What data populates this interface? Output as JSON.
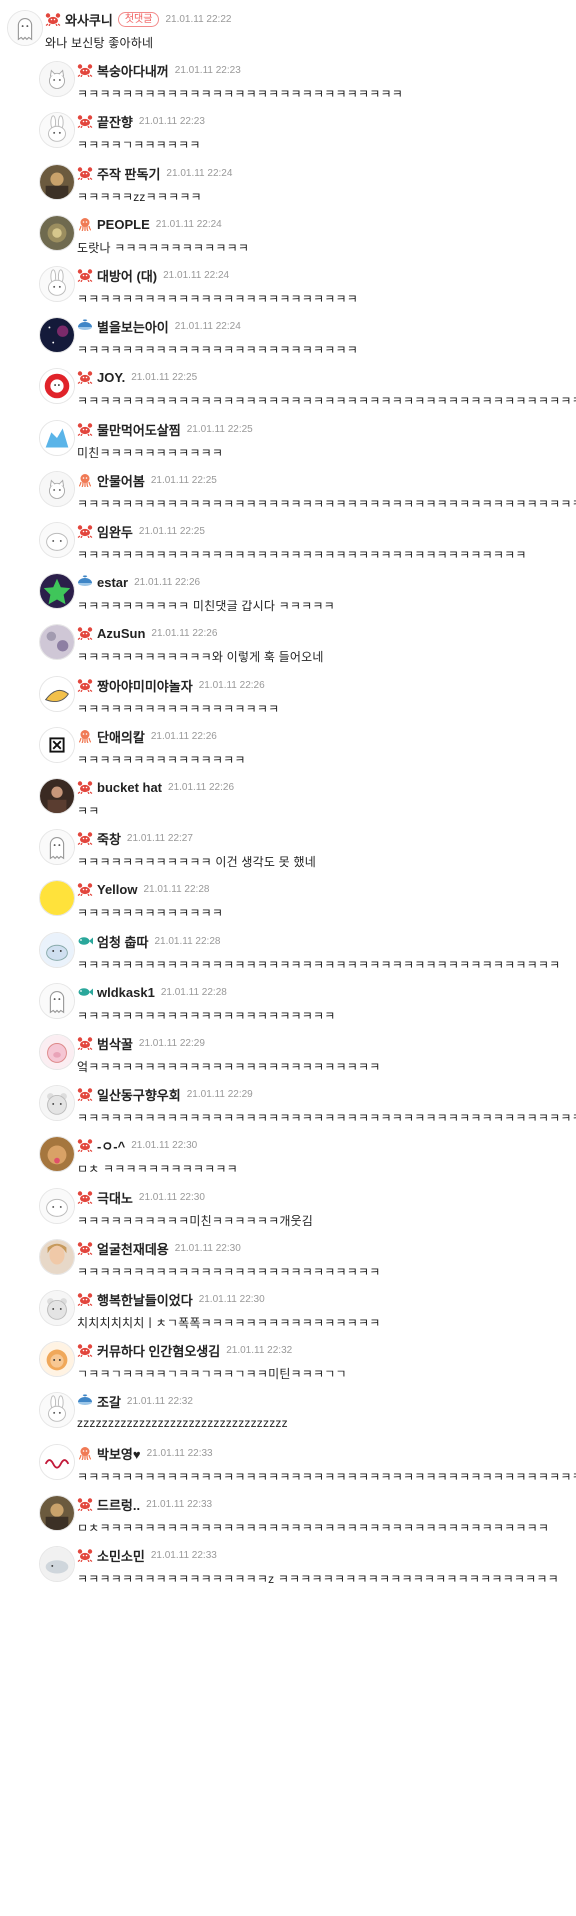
{
  "comments": [
    {
      "nick": "와사쿠니",
      "time": "21.01.11 22:22",
      "text": "와나 보신탕 좋아하네",
      "badge": "첫댓글",
      "level": "crab",
      "avatar": "ghost-avatar",
      "reply": false
    },
    {
      "nick": "복숭아다내꺼",
      "time": "21.01.11 22:23",
      "text": "ㅋㅋㅋㅋㅋㅋㅋㅋㅋㅋㅋㅋㅋㅋㅋㅋㅋㅋㅋㅋㅋㅋㅋㅋㅋㅋㅋㅋㅋ",
      "level": "crab",
      "avatar": "cat-avatar",
      "reply": true
    },
    {
      "nick": "끝잔향",
      "time": "21.01.11 22:23",
      "text": "ㅋㅋㅋㅋㄱㅋㅋㅋㅋㅋㅋ",
      "level": "crab",
      "avatar": "rabbit-avatar",
      "reply": true
    },
    {
      "nick": "주작 판독기",
      "time": "21.01.11 22:24",
      "text": "ㅋㅋㅋㅋㅋzzㅋㅋㅋㅋㅋ",
      "level": "crab",
      "avatar": "photo-avatar",
      "reply": true
    },
    {
      "nick": "PEOPLE",
      "time": "21.01.11 22:24",
      "text": "도랏나 ㅋㅋㅋㅋㅋㅋㅋㅋㅋㅋㅋㅋ",
      "level": "octopus",
      "avatar": "mosaic-avatar",
      "reply": true
    },
    {
      "nick": "대방어 (대)",
      "time": "21.01.11 22:24",
      "text": "ㅋㅋㅋㅋㅋㅋㅋㅋㅋㅋㅋㅋㅋㅋㅋㅋㅋㅋㅋㅋㅋㅋㅋㅋㅋ",
      "level": "crab",
      "avatar": "rabbit-avatar",
      "reply": true
    },
    {
      "nick": "별을보는아이",
      "time": "21.01.11 22:24",
      "text": "ㅋㅋㅋㅋㅋㅋㅋㅋㅋㅋㅋㅋㅋㅋㅋㅋㅋㅋㅋㅋㅋㅋㅋㅋㅋ",
      "level": "whale",
      "avatar": "space-avatar",
      "reply": true
    },
    {
      "nick": "JOY.",
      "time": "21.01.11 22:25",
      "text": "ㅋㅋㅋㅋㅋㅋㅋㅋㅋㅋㅋㅋㅋㅋㅋㅋㅋㅋㅋㅋㅋㅋㅋㅋㅋㅋㅋㅋㅋㅋㅋㅋㅋㅋㅋㅋㅋㅋㅋㅋㅋㅋㅋㅋㅋthl발ㅋㅋ",
      "level": "crab",
      "avatar": "red-avatar",
      "reply": true
    },
    {
      "nick": "물만먹어도살찜",
      "time": "21.01.11 22:25",
      "text": "미친ㅋㅋㅋㅋㅋㅋㅋㅋㅋㅋㅋ",
      "level": "crab",
      "avatar": "blue-avatar",
      "reply": true
    },
    {
      "nick": "안물어봄",
      "time": "21.01.11 22:25",
      "text": "ㅋㅋㅋㅋㅋㅋㅋㅋㅋㅋㅋㅋㅋㅋㅋㅋㅋㅋㅋㅋㅋㅋㅋㅋㅋㅋㅋㅋㅋㅋㅋㅋㅋㅋㅋㅋㅋㅋㅋㅋㅋㅋㅋㅋㅋㅋㅋㅋㅋ",
      "level": "octopus",
      "avatar": "cat-avatar",
      "reply": true
    },
    {
      "nick": "임완두",
      "time": "21.01.11 22:25",
      "text": "ㅋㅋㅋㅋㅋㅋㅋㅋㅋㅋㅋㅋㅋㅋㅋㅋㅋㅋㅋㅋㅋㅋㅋㅋㅋㅋㅋㅋㅋㅋㅋㅋㅋㅋㅋㅋㅋㅋㅋㅋ",
      "level": "crab",
      "avatar": "blob-avatar",
      "reply": true
    },
    {
      "nick": "estar",
      "time": "21.01.11 22:26",
      "text": "ㅋㅋㅋㅋㅋㅋㅋㅋㅋㅋ 미친댓글 갑시다 ㅋㅋㅋㅋㅋ",
      "level": "whale",
      "avatar": "star-avatar",
      "reply": true
    },
    {
      "nick": "AzuSun",
      "time": "21.01.11 22:26",
      "text": "ㅋㅋㅋㅋㅋㅋㅋㅋㅋㅋㅋㅋ와 이렇게 훅 들어오네",
      "level": "crab",
      "avatar": "floral-avatar",
      "reply": true
    },
    {
      "nick": "짱아야미미야놀자",
      "time": "21.01.11 22:26",
      "text": "ㅋㅋㅋㅋㅋㅋㅋㅋㅋㅋㅋㅋㅋㅋㅋㅋㅋㅋ",
      "level": "crab",
      "avatar": "sketch-avatar",
      "reply": true
    },
    {
      "nick": "단애의칼",
      "time": "21.01.11 22:26",
      "text": "ㅋㅋㅋㅋㅋㅋㅋㅋㅋㅋㅋㅋㅋㅋㅋ",
      "level": "octopus",
      "avatar": "box-avatar",
      "reply": true
    },
    {
      "nick": "bucket hat",
      "time": "21.01.11 22:26",
      "text": "ㅋㅋ",
      "level": "crab",
      "avatar": "person-avatar",
      "reply": true
    },
    {
      "nick": "죽창",
      "time": "21.01.11 22:27",
      "text": "ㅋㅋㅋㅋㅋㅋㅋㅋㅋㅋㅋㅋ 이건 생각도 못 했네",
      "level": "crab",
      "avatar": "ghost-avatar",
      "reply": true
    },
    {
      "nick": "Yellow",
      "time": "21.01.11 22:28",
      "text": "ㅋㅋㅋㅋㅋㅋㅋㅋㅋㅋㅋㅋㅋ",
      "level": "crab",
      "avatar": "yellow-avatar",
      "reply": true
    },
    {
      "nick": "엄청 춥따",
      "time": "21.01.11 22:28",
      "text": "ㅋㅋㅋㅋㅋㅋㅋㅋㅋㅋㅋㅋㅋㅋㅋㅋㅋㅋㅋㅋㅋㅋㅋㅋㅋㅋㅋㅋㅋㅋㅋㅋㅋㅋㅋㅋㅋㅋㅋㅋㅋㅋㅋ",
      "level": "fish",
      "avatar": "seal-avatar",
      "reply": true
    },
    {
      "nick": "wldkask1",
      "time": "21.01.11 22:28",
      "text": "ㅋㅋㅋㅋㅋㅋㅋㅋㅋㅋㅋㅋㅋㅋㅋㅋㅋㅋㅋㅋㅋㅋㅋ",
      "level": "fish",
      "avatar": "ghost-avatar",
      "reply": true
    },
    {
      "nick": "범삭꿀",
      "time": "21.01.11 22:29",
      "text": "엌ㅋㅋㅋㅋㅋㅋㅋㅋㅋㅋㅋㅋㅋㅋㅋㅋㅋㅋㅋㅋㅋㅋㅋㅋㅋㅋ",
      "level": "crab",
      "avatar": "pig-avatar",
      "reply": true
    },
    {
      "nick": "일산동구향우회",
      "time": "21.01.11 22:29",
      "text": "ㅋㅋㅋㅋㅋㅋㅋㅋㅋㅋㅋㅋㅋㅋㅋㅋㅋㅋㅋㅋㅋㅋㅋㅋㅋㅋㅋㅋㅋㅋㅋㅋㅋㅋㅋㅋㅋㅋㅋㅋㅋㅋㅋㅋㅋㅋㅋㅋㅋㅋ",
      "level": "crab",
      "avatar": "bear-avatar",
      "reply": true
    },
    {
      "nick": "-ㅇ-^",
      "time": "21.01.11 22:30",
      "text": "ㅁㅊ ㅋㅋㅋㅋㅋㅋㅋㅋㅋㅋㅋㅋ",
      "level": "crab",
      "avatar": "dog-avatar",
      "reply": true
    },
    {
      "nick": "극대노",
      "time": "21.01.11 22:30",
      "text": "ㅋㅋㅋㅋㅋㅋㅋㅋㅋㅋ미친ㅋㅋㅋㅋㅋㅋ개웃김",
      "level": "crab",
      "avatar": "blob-avatar",
      "reply": true
    },
    {
      "nick": "얼굴천재데용",
      "time": "21.01.11 22:30",
      "text": "ㅋㅋㅋㅋㅋㅋㅋㅋㅋㅋㅋㅋㅋㅋㅋㅋㅋㅋㅋㅋㅋㅋㅋㅋㅋㅋㅋ",
      "level": "crab",
      "avatar": "face-avatar",
      "reply": true
    },
    {
      "nick": "행복한날들이었다",
      "time": "21.01.11 22:30",
      "text": "치치치치치치ㅣㅊㄱ폭폭ㅋㅋㅋㅋㅋㅋㅋㅋㅋㅋㅋㅋㅋㅋㅋㅋ",
      "level": "crab",
      "avatar": "bear-avatar",
      "reply": true
    },
    {
      "nick": "커뮤하다 인간혐오생김",
      "time": "21.01.11 22:32",
      "text": "ㄱㅋㅋㄱㅋㅋㅋㅋㄱㅋㅋㄱㅋㅋㄱㅋㅋ미틴ㅋㅋㅋㄱㄱ",
      "level": "crab",
      "avatar": "lion-avatar",
      "reply": true
    },
    {
      "nick": "조갈",
      "time": "21.01.11 22:32",
      "text": "zzzzzzzzzzzzzzzzzzzzzzzzzzzzzzzzzz",
      "level": "whale",
      "avatar": "rabbit-avatar",
      "reply": true
    },
    {
      "nick": "박보영♥",
      "time": "21.01.11 22:33",
      "text": "ㅋㅋㅋㅋㅋㅋㅋㅋㅋㅋㅋㅋㅋㅋㅋㅋㅋㅋㅋㅋㅋㅋㅋㅋㅋㅋㅋㅋㅋㅋㅋㅋㅋㅋㅋㅋㅋㅋㅋㅋㅋㅋㅋㅋㅋㅋㅋㅋㅋㅋ",
      "level": "octopus",
      "avatar": "sign-avatar",
      "reply": true
    },
    {
      "nick": "드르렁..",
      "time": "21.01.11 22:33",
      "text": "ㅁㅊㅋㅋㅋㅋㅋㅋㅋㅋㅋㅋㅋㅋㅋㅋㅋㅋㅋㅋㅋㅋㅋㅋㅋㅋㅋㅋㅋㅋㅋㅋㅋㅋㅋㅋㅋㅋㅋㅋㅋㅋ",
      "level": "crab",
      "avatar": "photo-avatar",
      "reply": true
    },
    {
      "nick": "소민소민",
      "time": "21.01.11 22:33",
      "text": "ㅋㅋㅋㅋㅋㅋㅋㅋㅋㅋㅋㅋㅋㅋㅋㅋㅋz ㅋㅋㅋㅋㅋㅋㅋㅋㅋㅋㅋㅋㅋㅋㅋㅋㅋㅋㅋㅋㅋㅋㅋㅋㅋ",
      "level": "crab",
      "avatar": "whale-avatar",
      "reply": true
    }
  ],
  "colors": {
    "crab": "#e2463d",
    "octopus": "#f07a55",
    "whale": "#3f86c7",
    "fish": "#2aa79b",
    "badge": "#f05a5a"
  }
}
